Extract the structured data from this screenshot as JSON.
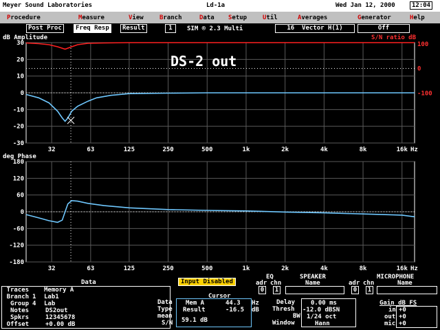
{
  "titlebar": {
    "app": "Meyer Sound Laboratories",
    "file": "Ld-1a",
    "date": "Wed Jan 12, 2000",
    "clock": "12:04"
  },
  "menu": [
    {
      "hk": "P",
      "rest": "rocedure"
    },
    {
      "hk": "M",
      "rest": "easure"
    },
    {
      "hk": "V",
      "rest": "iew"
    },
    {
      "hk": "B",
      "rest": "ranch"
    },
    {
      "hk": "D",
      "rest": "ata"
    },
    {
      "hk": "S",
      "rest": "etup"
    },
    {
      "hk": "U",
      "rest": "til"
    },
    {
      "hk": "A",
      "rest": "verages"
    },
    {
      "hk": "G",
      "rest": "enerator"
    },
    {
      "hk": "H",
      "rest": "elp"
    }
  ],
  "controls": {
    "post_proc": "Post Proc",
    "freq_resp": "Freq Resp",
    "result": "Result",
    "channel": "1",
    "sim": "SIM ® 2.3 Multi",
    "vector": "16  Vector H(1)",
    "off": "Off"
  },
  "amp_plot": {
    "ylabel": "dB Amplitude",
    "sn_label": "S/N ratio dB",
    "annotation": "DS-2 out",
    "yticks": [
      "30",
      "20",
      "10",
      "0",
      "-10",
      "-20",
      "-30"
    ],
    "sn_ticks": [
      "100",
      "0",
      "-100"
    ],
    "xticks": [
      "32",
      "63",
      "125",
      "250",
      "500",
      "1k",
      "2k",
      "4k",
      "8k",
      "16k"
    ],
    "hz": "Hz"
  },
  "phase_plot": {
    "ylabel": "deg Phase",
    "yticks": [
      "180",
      "120",
      "60",
      "0",
      "-60",
      "-120",
      "-180"
    ],
    "xticks": [
      "32",
      "63",
      "125",
      "250",
      "500",
      "1k",
      "2k",
      "4k",
      "8k",
      "16k"
    ],
    "hz": "Hz"
  },
  "chart_data": [
    {
      "type": "line",
      "title": "",
      "ylabel": "dB Amplitude",
      "xlabel": "Hz",
      "xscale": "log",
      "xlim": [
        20,
        20000
      ],
      "ylim": [
        -30,
        30
      ],
      "grid": true,
      "series": [
        {
          "x": [
            20,
            25,
            30,
            35,
            38,
            40,
            42,
            45,
            50,
            60,
            70,
            90,
            125,
            250,
            500,
            1000,
            2000,
            4000,
            8000,
            16000,
            20000
          ],
          "y": [
            -1,
            -3,
            -6,
            -11,
            -15,
            -17,
            -15,
            -11,
            -8,
            -5,
            -3,
            -1.5,
            -0.5,
            -0.2,
            0,
            0,
            0,
            0,
            0,
            0,
            0
          ]
        }
      ]
    },
    {
      "type": "line",
      "title": "",
      "ylabel": "S/N ratio dB",
      "xscale": "log",
      "xlim": [
        20,
        20000
      ],
      "ylim": [
        -150,
        150
      ],
      "series": [
        {
          "x": [
            20,
            25,
            30,
            35,
            40,
            45,
            50,
            60,
            80,
            125,
            250,
            1000,
            20000
          ],
          "y": [
            145,
            143,
            140,
            134,
            127,
            134,
            140,
            144,
            145,
            146,
            146,
            146,
            146
          ]
        }
      ]
    },
    {
      "type": "line",
      "title": "",
      "ylabel": "deg Phase",
      "xlabel": "Hz",
      "xscale": "log",
      "xlim": [
        20,
        20000
      ],
      "ylim": [
        -180,
        180
      ],
      "grid": true,
      "series": [
        {
          "x": [
            20,
            25,
            30,
            35,
            38,
            40,
            42,
            45,
            50,
            60,
            80,
            125,
            250,
            500,
            1000,
            2000,
            4000,
            8000,
            16000,
            20000
          ],
          "y": [
            -10,
            -22,
            -32,
            -38,
            -30,
            0,
            28,
            40,
            38,
            30,
            22,
            14,
            8,
            5,
            3,
            -1,
            -4,
            -8,
            -12,
            -18
          ]
        }
      ]
    }
  ],
  "status": {
    "input_disabled": "Input Disabled"
  },
  "data_panel": {
    "title": "Data",
    "rows": [
      {
        "label": "Traces",
        "idx": "",
        "value": "Memory A"
      },
      {
        "label": "Branch",
        "idx": "1",
        "value": "Lab1"
      },
      {
        "label": "Group",
        "idx": "4",
        "value": "Lab"
      },
      {
        "label": "Notes",
        "idx": "",
        "value": "DS2out"
      },
      {
        "label": "Spkrs",
        "idx": "",
        "value": "12345678"
      },
      {
        "label": "Offset",
        "idx": "",
        "value": "+0.00 dB"
      }
    ]
  },
  "cursor_panel": {
    "title": "Cursor",
    "data_label": "Data",
    "type_label": "Type",
    "mean_label": "mean",
    "sn_label": "S/N",
    "data_value": "Mem A",
    "freq": "44.3",
    "freq_unit": "Hz",
    "type_value": "Result",
    "db_value": "-16.5",
    "db_unit": "dB",
    "sn_value": "59.1 dB"
  },
  "eq_panel": {
    "title": "EQ",
    "adr": "adr",
    "chn": "chn",
    "adr_val": "0",
    "chn_val": "1"
  },
  "speaker_panel": {
    "title": "SPEAKER",
    "name": "Name"
  },
  "mic_panel": {
    "title": "MICROPHONE",
    "adr": "adr",
    "chn": "chn",
    "adr_val": "0",
    "chn_val": "1",
    "name": "Name"
  },
  "delay_panel": {
    "delay_label": "Delay",
    "delay": "0.00 ms",
    "thresh_label": "Thresh",
    "thresh": "-12.0 dBSN",
    "bw_label": "BW",
    "bw": "1/24 oct",
    "window_label": "Window",
    "window": "Hann"
  },
  "gain_panel": {
    "title": "Gain dB FS",
    "in_label": "in",
    "in": "+0",
    "out_label": "out",
    "out": "+0",
    "mic_label": "mic",
    "mic": "+0"
  },
  "colors": {
    "trace": "#6fc8ff",
    "sn_trace": "#ff2020",
    "grid": "#5a5a5a",
    "axis": "#ffffff"
  }
}
